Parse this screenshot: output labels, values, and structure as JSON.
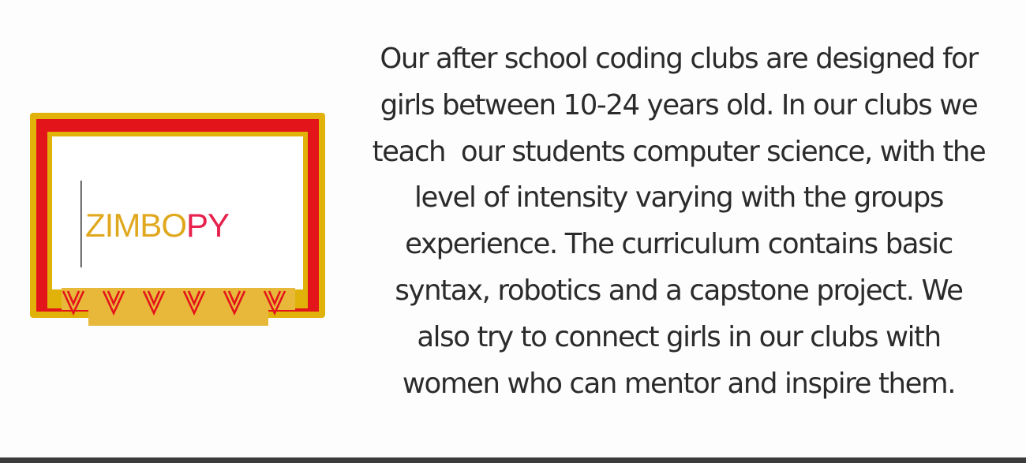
{
  "logo": {
    "part1": "ZIMBO",
    "part2": "PY",
    "icon": "chalkboard-frame-logo",
    "colors": {
      "gold": "#e0b20a",
      "red": "#e4141b",
      "text_gold": "#e0a81e",
      "text_pink": "#e6224d"
    }
  },
  "description": {
    "lines": [
      "Our after school coding clubs are designed for",
      "girls between 10-24 years old. In our clubs we",
      "teach  our students computer science, with the",
      "level of intensity varying with the groups",
      "experience. The curriculum contains basic",
      "syntax, robotics and a capstone project. We",
      "also try to connect girls in our clubs with",
      "women who can mentor and inspire them."
    ]
  }
}
